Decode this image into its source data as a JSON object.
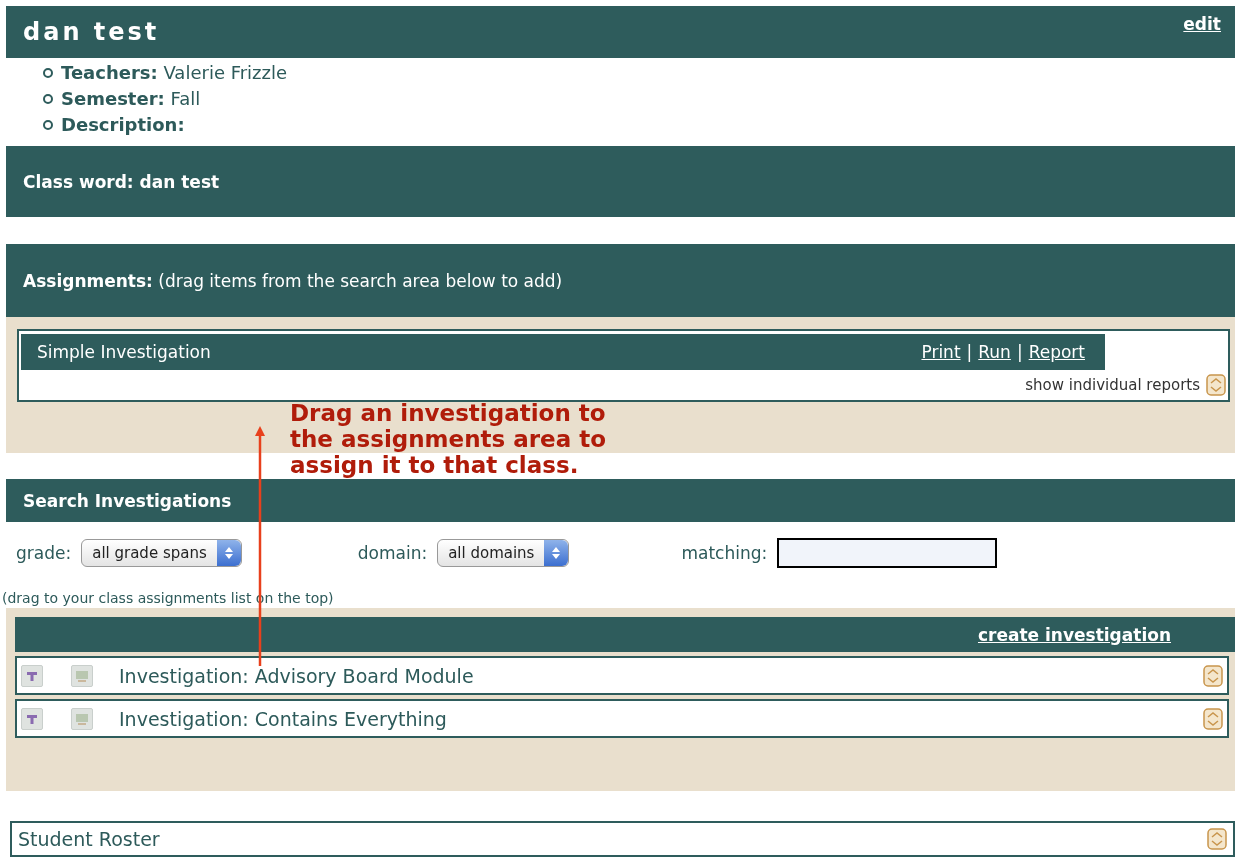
{
  "header": {
    "title": "dan test",
    "edit_link": "edit"
  },
  "details": [
    {
      "label": "Teachers:",
      "value": "Valerie Frizzle"
    },
    {
      "label": "Semester:",
      "value": "Fall"
    },
    {
      "label": "Description:"
    }
  ],
  "class_word": "Class word: dan test",
  "assignments": {
    "title": "Assignments:",
    "hint": "(drag items from the search area below to add)",
    "items": [
      {
        "name": "Simple Investigation",
        "links": [
          "Print",
          "Run",
          "Report"
        ],
        "link_separator": "|",
        "toggle_label": "show individual reports"
      }
    ]
  },
  "annotation": {
    "text": "Drag an investigation to the assignments area to assign it to that class."
  },
  "search": {
    "title": "Search Investigations",
    "filters": [
      {
        "kind": "select",
        "label": "grade:",
        "value": "all grade spans"
      },
      {
        "kind": "select",
        "label": "domain:",
        "value": "all domains"
      },
      {
        "kind": "text",
        "label": "matching:"
      }
    ],
    "hint": "(drag to your class assignments list on the top)",
    "create_link": "create investigation",
    "results": [
      {
        "name": "Investigation: Advisory Board Module"
      },
      {
        "name": "Investigation: Contains Everything"
      }
    ]
  },
  "roster": {
    "title": "Student Roster"
  }
}
